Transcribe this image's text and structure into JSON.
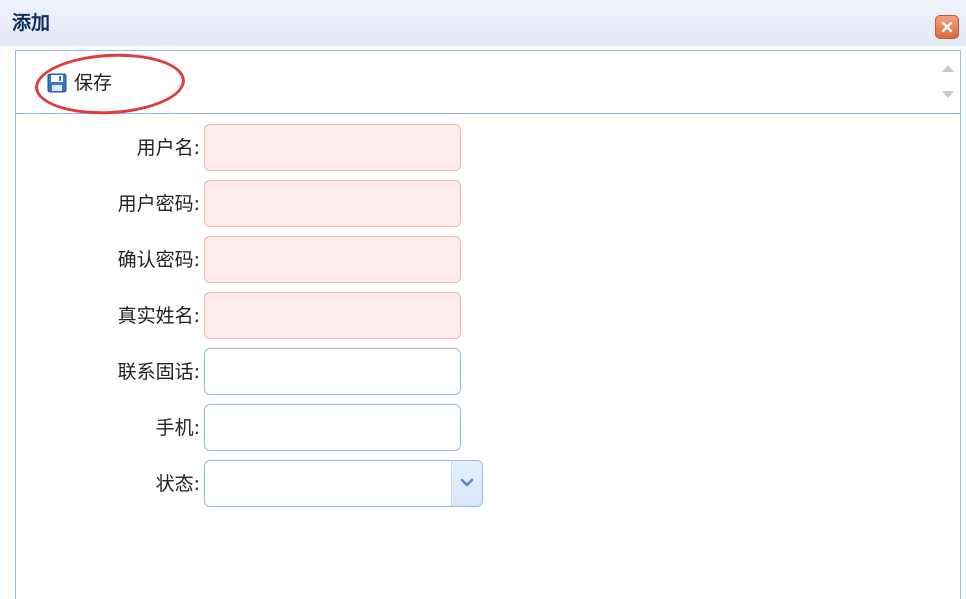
{
  "window": {
    "title": "添加"
  },
  "toolbar": {
    "save_label": "保存"
  },
  "form": {
    "fields": [
      {
        "label": "用户名:",
        "value": "",
        "invalid": true
      },
      {
        "label": "用户密码:",
        "value": "",
        "invalid": true
      },
      {
        "label": "确认密码:",
        "value": "",
        "invalid": true
      },
      {
        "label": "真实姓名:",
        "value": "",
        "invalid": true
      },
      {
        "label": "联系固话:",
        "value": "",
        "invalid": false
      },
      {
        "label": "手机:",
        "value": "",
        "invalid": false
      }
    ],
    "status": {
      "label": "状态:",
      "selected": ""
    }
  },
  "colors": {
    "title_text": "#0e2d5f",
    "border": "#99bbe8",
    "invalid_bg": "#ffecec",
    "invalid_border": "#f7b4b4",
    "annotation": "#e03a3a",
    "close_button": "#dd6a3f"
  },
  "icons": {
    "close": "close-icon",
    "save": "floppy-disk-icon",
    "select": "chevron-down-icon"
  }
}
